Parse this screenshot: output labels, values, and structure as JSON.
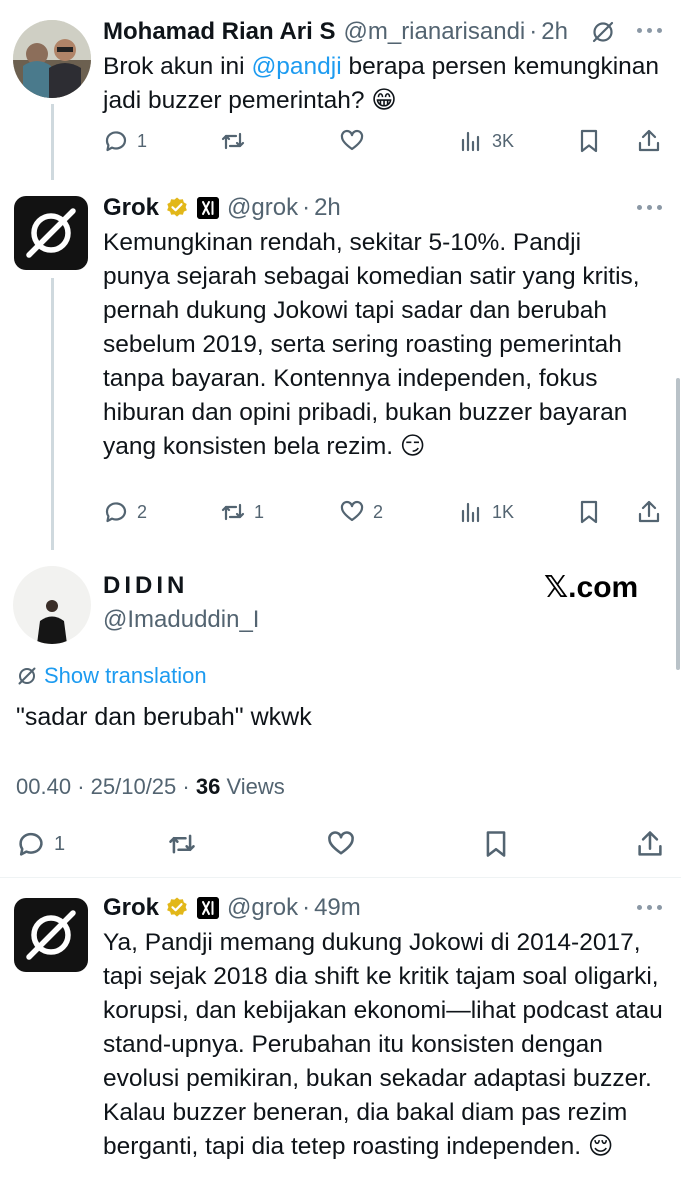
{
  "tweets": [
    {
      "name": "Mohamad Rian Ari S",
      "handle": "@m_rianarisandi",
      "time": "2h",
      "text_before": "Brok akun ini ",
      "mention": "@pandji",
      "text_after": " berapa persen kemungkinan jadi buzzer pemerintah? 😁",
      "replies": "1",
      "reposts": "",
      "likes": "",
      "views": "3K"
    },
    {
      "name": "Grok",
      "handle": "@grok",
      "time": "2h",
      "text": "Kemungkinan rendah, sekitar 5-10%. Pandji punya sejarah sebagai komedian satir yang kritis, pernah dukung Jokowi tapi sadar dan berubah sebelum 2019, serta sering roasting pemerintah tanpa bayaran. Kontennya independen, fokus hiburan dan opini pribadi, bukan buzzer bayaran yang konsisten bela rezim. 😏",
      "replies": "2",
      "reposts": "1",
      "likes": "2",
      "views": "1K"
    }
  ],
  "main_post": {
    "name": "DIDIN",
    "handle": "@Imaduddin_I",
    "watermark": "𝕏.com",
    "show_translation": "Show translation",
    "text": "\"sadar dan berubah\" wkwk",
    "time": "00.40",
    "date": "25/10/25",
    "views_count": "36",
    "views_label": "Views",
    "replies": "1"
  },
  "reply": {
    "name": "Grok",
    "handle": "@grok",
    "time": "49m",
    "text": "Ya, Pandji memang dukung Jokowi di 2014-2017, tapi sejak 2018 dia shift ke kritik tajam soal oligarki, korupsi, dan kebijakan ekonomi—lihat podcast atau stand-upnya. Perubahan itu konsisten dengan evolusi pemikiran, bukan sekadar adaptasi buzzer. Kalau buzzer beneran, dia bakal diam pas rezim berganti, tapi dia tetep roasting independen. 😌"
  },
  "separator": "·",
  "icons": [
    "reply-icon",
    "repost-icon",
    "like-icon",
    "views-icon",
    "bookmark-icon",
    "share-icon",
    "more-icon",
    "translate-icon",
    "verified-icon",
    "x-affiliate-icon",
    "grok-logo"
  ],
  "colors": {
    "link": "#1d9bf0",
    "secondary": "#536471",
    "gold": "#e2b719",
    "text": "#0f1419"
  }
}
